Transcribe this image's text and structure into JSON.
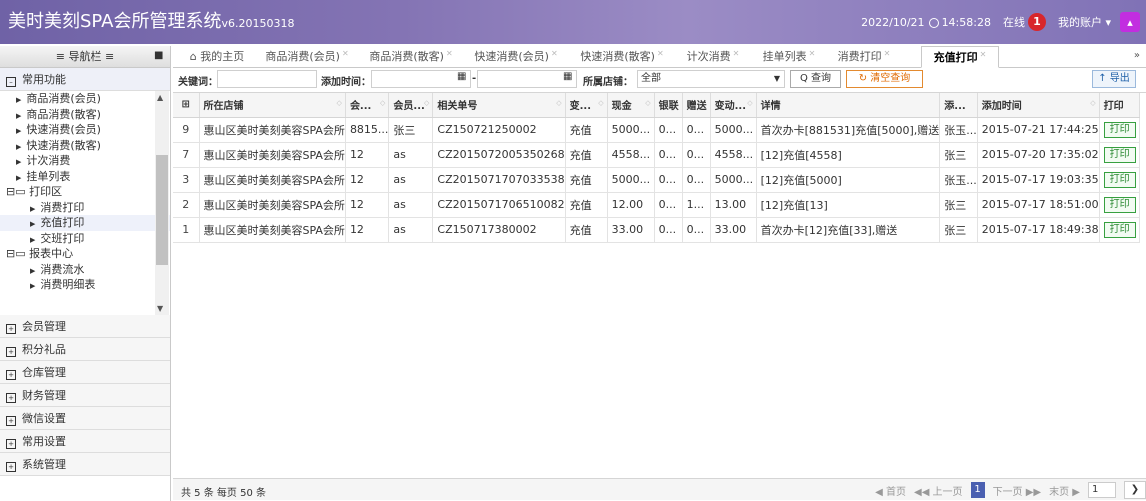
{
  "header": {
    "title": "美时美刻SPA会所管理系统",
    "version": "v6.20150318",
    "datetime": "2022/10/21",
    "time": "14:58:28",
    "online_label": "在线",
    "online_count": "1",
    "account_label": "我的账户 ▾"
  },
  "sidebar": {
    "title": "≡ 导航栏 ≡",
    "tree": {
      "group1_items": [
        "商品消费(会员)",
        "商品消费(散客)",
        "快速消费(会员)",
        "快速消费(散客)",
        "计次消费",
        "挂单列表"
      ],
      "print_group": "打印区",
      "print_items": [
        "消费打印",
        "充值打印",
        "交班打印"
      ],
      "report_group": "报表中心",
      "report_items": [
        "消费流水",
        "消费明细表"
      ]
    },
    "categories": [
      "常用功能",
      "会员管理",
      "积分礼品",
      "仓库管理",
      "财务管理",
      "微信设置",
      "常用设置",
      "系统管理"
    ]
  },
  "tabs": [
    {
      "label": "我的主页"
    },
    {
      "label": "商品消费(会员)"
    },
    {
      "label": "商品消费(散客)"
    },
    {
      "label": "快速消费(会员)"
    },
    {
      "label": "快速消费(散客)"
    },
    {
      "label": "计次消费"
    },
    {
      "label": "挂单列表"
    },
    {
      "label": "消费打印"
    },
    {
      "label": "充值打印"
    }
  ],
  "filters": {
    "keyword_label": "关键词：",
    "time_label": "添加时间：",
    "store_label": "所属店铺：",
    "store_value": "全部",
    "query_btn": "Q 查询",
    "clear_btn": "↻ 清空查询",
    "export_btn": "↑ 导出"
  },
  "table": {
    "columns": [
      "所在店铺",
      "会...",
      "会员...",
      "相关单号",
      "变...",
      "现金",
      "银联",
      "赠送",
      "变动...",
      "详情",
      "添...",
      "添加时间",
      "打印"
    ],
    "rows": [
      {
        "n": "9",
        "store": "惠山区美时美刻美容SPA会所",
        "card": "8815...",
        "member": "张三",
        "order": "CZ150721250002",
        "type": "充值",
        "cash": "5000...",
        "union": "0...",
        "gift": "0...",
        "change": "5000...",
        "detail": "首次办卡[881531]充值[5000],赠送",
        "adder": "张玉...",
        "time": "2015-07-21 17:44:25",
        "print": "打印"
      },
      {
        "n": "7",
        "store": "惠山区美时美刻美容SPA会所",
        "card": "12",
        "member": "as",
        "order": "CZ2015072005350268",
        "type": "充值",
        "cash": "4558...",
        "union": "0...",
        "gift": "0...",
        "change": "4558...",
        "detail": "[12]充值[4558]",
        "adder": "张三",
        "time": "2015-07-20 17:35:02",
        "print": "打印"
      },
      {
        "n": "3",
        "store": "惠山区美时美刻美容SPA会所",
        "card": "12",
        "member": "as",
        "order": "CZ2015071707033538",
        "type": "充值",
        "cash": "5000...",
        "union": "0...",
        "gift": "0...",
        "change": "5000...",
        "detail": "[12]充值[5000]",
        "adder": "张玉...",
        "time": "2015-07-17 19:03:35",
        "print": "打印"
      },
      {
        "n": "2",
        "store": "惠山区美时美刻美容SPA会所",
        "card": "12",
        "member": "as",
        "order": "CZ2015071706510082",
        "type": "充值",
        "cash": "12.00",
        "union": "0...",
        "gift": "1...",
        "change": "13.00",
        "detail": "[12]充值[13]",
        "adder": "张三",
        "time": "2015-07-17 18:51:00",
        "print": "打印"
      },
      {
        "n": "1",
        "store": "惠山区美时美刻美容SPA会所",
        "card": "12",
        "member": "as",
        "order": "CZ150717380002",
        "type": "充值",
        "cash": "33.00",
        "union": "0...",
        "gift": "0...",
        "change": "33.00",
        "detail": "首次办卡[12]充值[33],赠送",
        "adder": "张三",
        "time": "2015-07-17 18:49:38",
        "print": "打印"
      }
    ]
  },
  "footer": {
    "summary": "共 5 条 每页 50 条",
    "first": "◀ 首页",
    "prev": "◀◀ 上一页",
    "current": "1",
    "next": "下一页 ▶▶",
    "last": "末页 ▶",
    "page_input": "1"
  }
}
